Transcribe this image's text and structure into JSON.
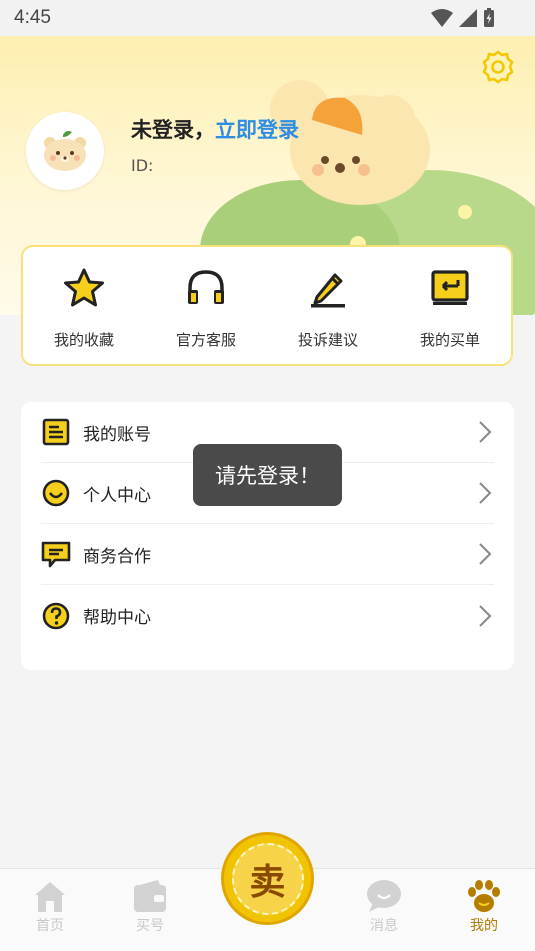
{
  "status_bar": {
    "time": "4:45"
  },
  "profile": {
    "login_status": "未登录，",
    "login_link": "立即登录",
    "id_label": "ID:",
    "id_value": ""
  },
  "quick_actions": [
    {
      "label": "我的收藏",
      "icon": "star-icon"
    },
    {
      "label": "官方客服",
      "icon": "headphones-icon"
    },
    {
      "label": "投诉建议",
      "icon": "pencil-icon"
    },
    {
      "label": "我的买单",
      "icon": "order-icon"
    }
  ],
  "menu": [
    {
      "label": "我的账号",
      "icon": "account-icon"
    },
    {
      "label": "个人中心",
      "icon": "smile-icon"
    },
    {
      "label": "商务合作",
      "icon": "message-icon"
    },
    {
      "label": "帮助中心",
      "icon": "help-icon"
    }
  ],
  "toast": {
    "text": "请先登录！"
  },
  "tabbar": {
    "items": [
      {
        "label": "首页",
        "icon": "home-icon",
        "active": false
      },
      {
        "label": "买号",
        "icon": "wallet-icon",
        "active": false
      },
      {
        "label": "消息",
        "icon": "chat-icon",
        "active": false
      },
      {
        "label": "我的",
        "icon": "paw-icon",
        "active": true
      }
    ],
    "center_button": {
      "char": "卖",
      "icon": "sell-badge-icon"
    }
  },
  "colors": {
    "accent_yellow": "#f7d11e",
    "link_blue": "#2f8de4",
    "active_tab": "#b07b00",
    "inactive_tab": "#c8c8c8"
  }
}
